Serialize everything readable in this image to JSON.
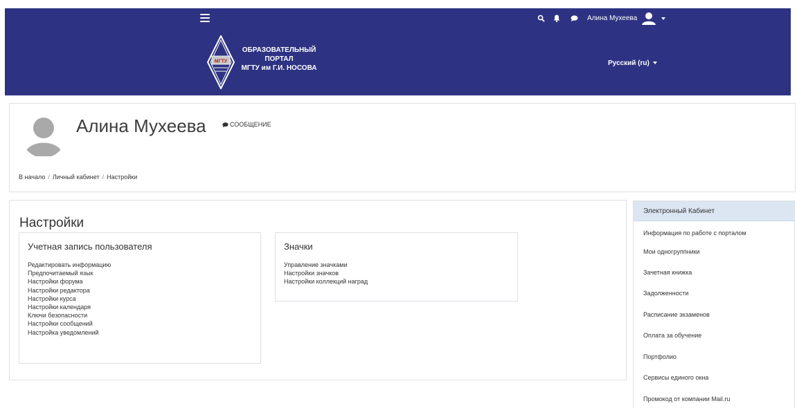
{
  "topbar": {
    "user_name": "Алина Мухеева",
    "icons": [
      "menu-icon",
      "search-icon",
      "bell-icon",
      "chat-icon",
      "avatar-icon",
      "caret-down-icon"
    ],
    "color": "#2d3382"
  },
  "banner": {
    "logo_badge": "МГТУ",
    "logo_lines": [
      "ОБРАЗОВАТЕЛЬНЫЙ",
      "ПОРТАЛ",
      "МГТУ им Г.И. НОСОВА"
    ],
    "language": "Русский (ru)"
  },
  "profile": {
    "name": "Алина Мухеева",
    "message_label": "СООБЩЕНИЕ",
    "breadcrumb": [
      "В начало",
      "Личный кабинет",
      "Настройки"
    ]
  },
  "main": {
    "title": "Настройки",
    "account": {
      "title": "Учетная запись пользователя",
      "links": [
        "Редактировать информацию",
        "Предпочитаемый язык",
        "Настройки форума",
        "Настройки редактора",
        "Настройки курса",
        "Настройки календаря",
        "Ключи безопасности",
        "Настройки сообщений",
        "Настройка уведомлений"
      ]
    },
    "badges": {
      "title": "Значки",
      "links": [
        "Управление значками",
        "Настройки значков",
        "Настройки коллекций наград"
      ]
    }
  },
  "side": {
    "title": "Электронный Кабинет",
    "items": [
      "Информация по работе с порталом",
      "Мои одногруппники",
      "Зачетная книжка",
      "Задолженности",
      "Расписание экзаменов",
      "Оплата за обучение",
      "Портфолио",
      "Сервисы единого окна",
      "Промокод от компании Mail.ru"
    ]
  }
}
